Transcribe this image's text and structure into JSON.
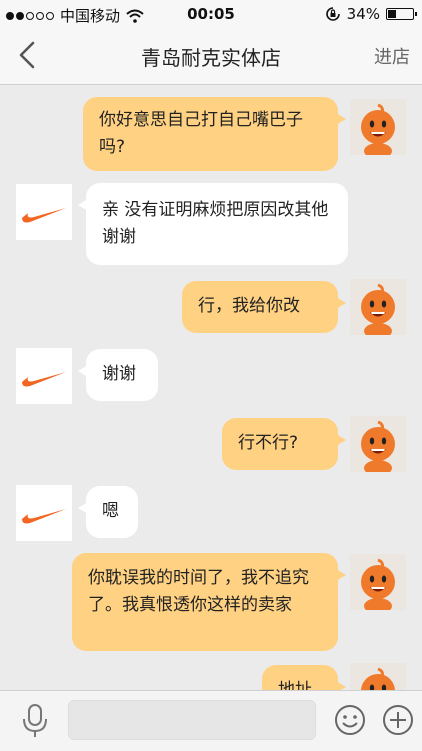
{
  "status": {
    "carrier": "中国移动",
    "time": "00:05",
    "battery": "34%"
  },
  "nav": {
    "title": "青岛耐克实体店",
    "enter_label": "进店"
  },
  "messages": [
    {
      "from": "me",
      "text": "你好意思自己打自己嘴巴子吗?"
    },
    {
      "from": "shop",
      "text": "亲 没有证明麻烦把原因改其他 谢谢"
    },
    {
      "from": "me",
      "text": "行，我给你改"
    },
    {
      "from": "shop",
      "text": "谢谢"
    },
    {
      "from": "me",
      "text": "行不行?"
    },
    {
      "from": "shop",
      "text": "嗯"
    },
    {
      "from": "me",
      "text": "你耽误我的时间了，我不追究了。我真恨透你这样的卖家"
    },
    {
      "from": "me",
      "text": "地址"
    }
  ],
  "input": {
    "placeholder": ""
  },
  "colors": {
    "my_bubble": "#ffd183",
    "shop_bubble": "#ffffff",
    "nike_swoosh": "#f26522",
    "mascot": "#f07a2b"
  }
}
